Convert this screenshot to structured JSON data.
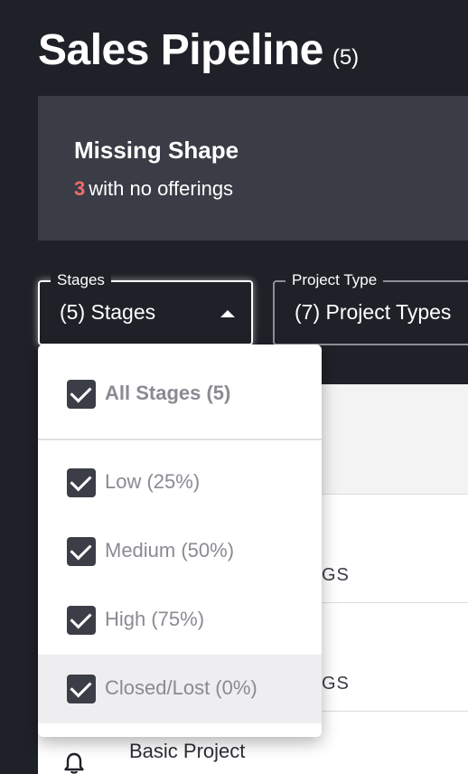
{
  "page": {
    "title": "Sales Pipeline",
    "count": "(5)"
  },
  "missing_shape": {
    "title": "Missing Shape",
    "count": "3",
    "suffix": "with no offerings"
  },
  "filters": {
    "stages": {
      "label": "Stages",
      "value": "(5) Stages"
    },
    "project_type": {
      "label": "Project Type",
      "value": "(7) Project Types"
    }
  },
  "stages_dropdown": {
    "all": {
      "label": "All Stages (5)",
      "checked": true
    },
    "options": [
      {
        "label": "Low (25%)",
        "checked": true
      },
      {
        "label": "Medium (50%)",
        "checked": true
      },
      {
        "label": "High (75%)",
        "checked": true
      },
      {
        "label": "Closed/Lost (0%)",
        "checked": true
      }
    ]
  },
  "table": {
    "rows_peek": [
      "GS",
      "GS"
    ],
    "last_row_label": "Basic Project"
  },
  "colors": {
    "background": "#1f2128",
    "card": "#3a3c46",
    "accent_red": "#f26b6b",
    "checkbox": "#3c3e47"
  },
  "icons": {
    "dropdown_caret": "caret-up-icon",
    "checkbox": "checkbox-checked-icon",
    "row_icon": "bell-icon"
  }
}
